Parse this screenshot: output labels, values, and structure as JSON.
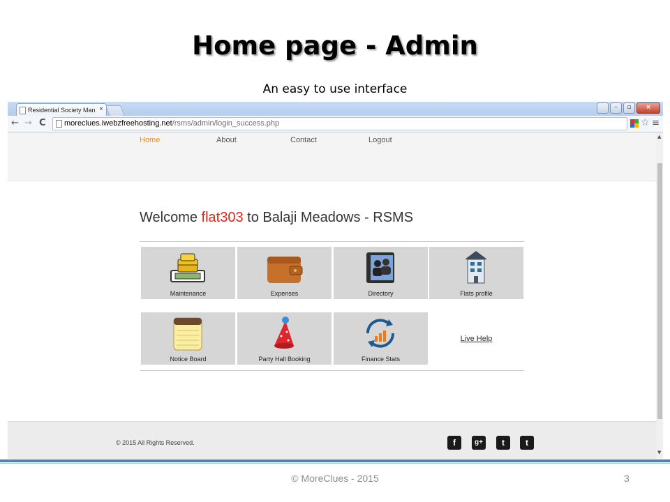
{
  "slide": {
    "title": "Home page - Admin",
    "subtitle": "An easy to use interface",
    "footer": "© MoreClues - 2015",
    "page_number": "3"
  },
  "browser": {
    "tab_title": "Residential Society Manag",
    "tab_close": "×",
    "url_host": "moreclues.iwebzfreehosting.net",
    "url_path": "/rsms/admin/login_success.php",
    "back": "←",
    "forward": "→",
    "reload": "C",
    "star": "☆",
    "menu": "≡",
    "close": "×"
  },
  "site": {
    "nav": [
      "Home",
      "About",
      "Contact",
      "Logout"
    ],
    "active_nav": "Home",
    "welcome_prefix": "Welcome ",
    "username": "flat303",
    "welcome_suffix": " to Balaji Meadows - RSMS",
    "tiles": [
      {
        "label": "Maintenance",
        "icon": "money-icon"
      },
      {
        "label": "Expenses",
        "icon": "wallet-icon"
      },
      {
        "label": "Directory",
        "icon": "address-book-icon"
      },
      {
        "label": "Flats profile",
        "icon": "building-icon"
      },
      {
        "label": "Notice Board",
        "icon": "notepad-icon"
      },
      {
        "label": "Party Hall Booking",
        "icon": "party-hat-icon"
      },
      {
        "label": "Finance Stats",
        "icon": "stats-cycle-icon"
      }
    ],
    "live_help": "Live Help",
    "copyright": "© 2015 All Rights Reserved.",
    "social": [
      {
        "name": "facebook-icon",
        "glyph": "f"
      },
      {
        "name": "google-plus-icon",
        "glyph": "g+"
      },
      {
        "name": "twitter-icon",
        "glyph": "t"
      },
      {
        "name": "tumblr-icon",
        "glyph": "t"
      }
    ]
  },
  "colors": {
    "accent_nav": "#f08a24",
    "username": "#e0251b",
    "slide_rule": "#4f81bd"
  }
}
